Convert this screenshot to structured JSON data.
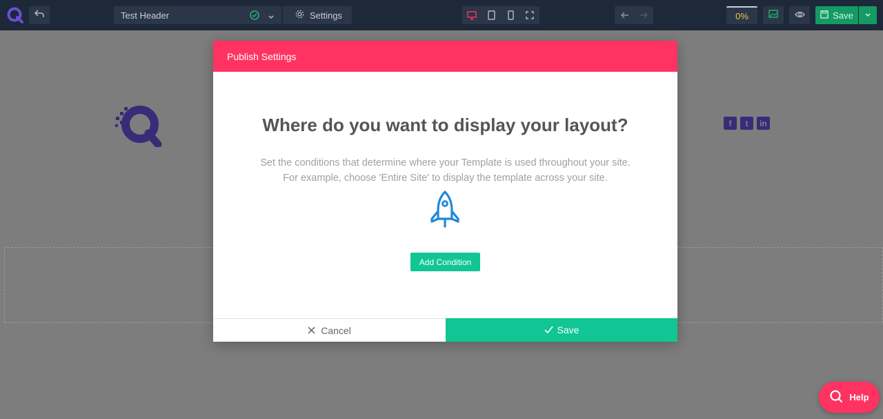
{
  "toolbar": {
    "header_name": "Test Header",
    "settings_label": "Settings",
    "progress": "0%",
    "save_label": "Save",
    "icons": [
      "q-logo-icon",
      "undo-icon",
      "check-circle-icon",
      "chevron-down-icon",
      "gear-icon",
      "desktop-icon",
      "tablet-icon",
      "mobile-icon",
      "fullscreen-icon",
      "arrow-left-icon",
      "arrow-right-icon",
      "image-icon",
      "eye-icon",
      "save-icon"
    ]
  },
  "modal": {
    "header": "Publish Settings",
    "title": "Where do you want to display your layout?",
    "desc_line1": "Set the conditions that determine where your Template is used throughout your site.",
    "desc_line2": "For example, choose 'Entire Site' to display the template across your site.",
    "add_condition_label": "Add Condition",
    "cancel_label": "Cancel",
    "save_label": "Save"
  },
  "help": {
    "label": "Help"
  },
  "colors": {
    "toolbar_bg": "#1d2838",
    "accent_pink": "#ff3361",
    "accent_green": "#11c594",
    "rocket_blue": "#1e88d8",
    "brand_purple": "#3a2b78"
  }
}
